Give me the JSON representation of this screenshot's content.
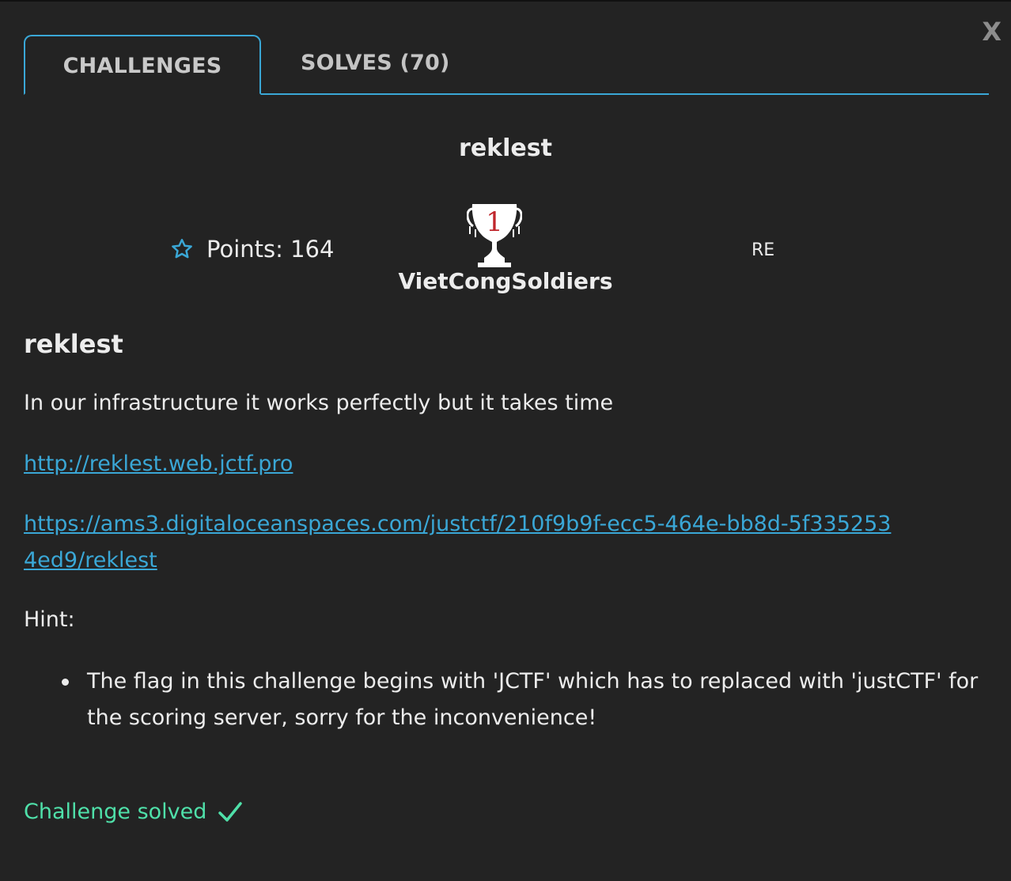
{
  "close_label": "X",
  "tabs": [
    {
      "label": "CHALLENGES"
    },
    {
      "label": "SOLVES (70)"
    }
  ],
  "challenge": {
    "name": "reklest",
    "points": "Points: 164",
    "first_blood_rank": "1",
    "first_blood_team": "VietCongSoldiers",
    "category": "RE",
    "description_heading": "reklest",
    "description": "In our infrastructure it works perfectly but it takes time",
    "links": [
      "http://reklest.web.jctf.pro",
      "https://ams3.digitaloceanspaces.com/justctf/210f9b9f-ecc5-464e-bb8d-5f3352534ed9/reklest"
    ],
    "hint_label": "Hint:",
    "hints": [
      "The flag in this challenge begins with 'JCTF' which has to replaced with 'justCTF' for the scoring server, sorry for the inconvenience!"
    ],
    "status": "Challenge solved"
  },
  "colors": {
    "accent": "#3aa7d6",
    "success": "#4fe0a9",
    "background": "#232323",
    "trophy_rank": "#c0272d"
  },
  "icons": {
    "close": "close-icon",
    "points": "star-outline-icon",
    "first_blood": "trophy-icon",
    "solved": "check-icon"
  }
}
